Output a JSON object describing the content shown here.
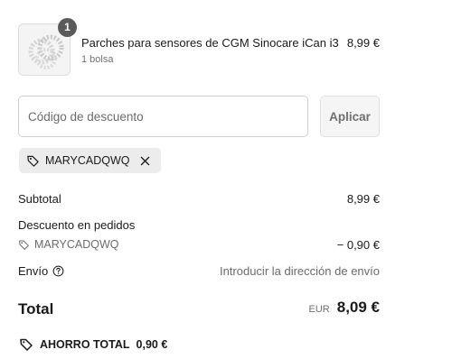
{
  "product": {
    "quantity": "1",
    "name": "Parches para sensores de CGM Sinocare iCan i3",
    "variant": "1 bolsa",
    "price": "8,99 €",
    "image_icon": "sensor-patches-image"
  },
  "discount": {
    "placeholder": "Código de descuento",
    "apply_label": "Aplicar",
    "applied_code": "MARYCADQWQ"
  },
  "summary": {
    "subtotal_label": "Subtotal",
    "subtotal_value": "8,99 €",
    "order_discount_label": "Descuento en pedidos",
    "discount_code": "MARYCADQWQ",
    "discount_value": "− 0,90 €",
    "shipping_label": "Envío",
    "shipping_value": "Introducir la dirección de envío"
  },
  "total": {
    "label": "Total",
    "currency": "EUR",
    "amount": "8,09 €"
  },
  "savings": {
    "label": "AHORRO TOTAL",
    "amount": "0,90 €"
  },
  "colors": {
    "text": "#1a1a1a",
    "muted": "#6b6b6b",
    "chip_bg": "#ececec",
    "badge": "#5a5a5a"
  }
}
